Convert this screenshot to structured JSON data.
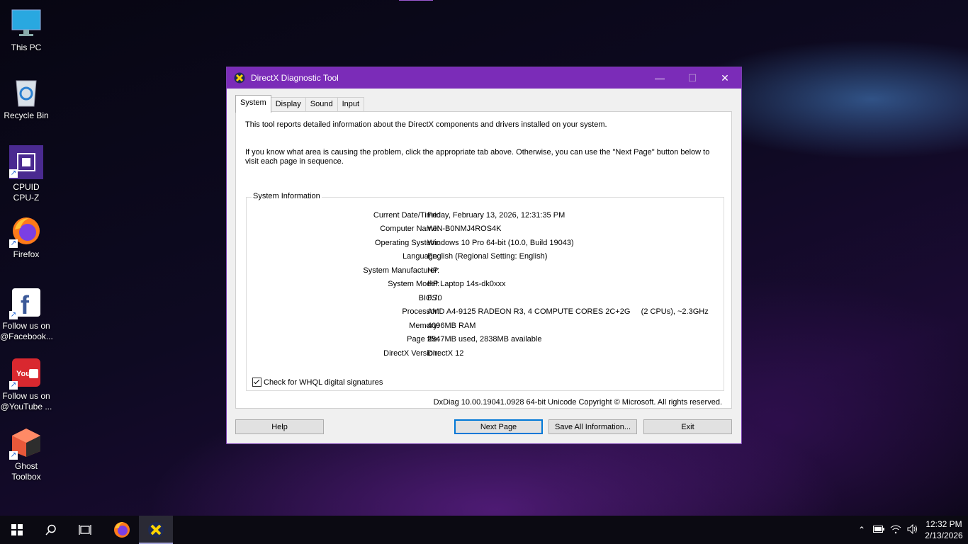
{
  "desktop": {
    "icons": [
      {
        "label": "This PC",
        "icon": "monitor-icon"
      },
      {
        "label": "Recycle Bin",
        "icon": "recycle-bin-icon"
      },
      {
        "label": "CPUID\nCPU-Z",
        "label_line1": "CPUID",
        "label_line2": "CPU-Z",
        "icon": "cpu-z-icon"
      },
      {
        "label": "Firefox",
        "icon": "firefox-icon"
      },
      {
        "label_line1": "Follow us on",
        "label_line2": "@Facebook...",
        "icon": "facebook-icon"
      },
      {
        "label_line1": "Follow us on",
        "label_line2": "@YouTube ...",
        "icon": "youtube-icon"
      },
      {
        "label_line1": "Ghost",
        "label_line2": "Toolbox",
        "icon": "ghost-toolbox-icon"
      }
    ]
  },
  "window": {
    "title": "DirectX Diagnostic Tool",
    "controls": {
      "minimize": "—",
      "maximize": "☐",
      "close": "✕"
    },
    "tabs": [
      "System",
      "Display",
      "Sound",
      "Input"
    ],
    "active_tab": "System",
    "intro_line1": "This tool reports detailed information about the DirectX components and drivers installed on your system.",
    "intro_line2": "If you know what area is causing the problem, click the appropriate tab above.  Otherwise, you can use the \"Next Page\" button below to",
    "intro_line3": "visit each page in sequence.",
    "group_title": "System Information",
    "info": [
      {
        "key": "Current Date/Time:",
        "value": "Friday, February 13, 2026, 12:31:35 PM"
      },
      {
        "key": "Computer Name:",
        "value": "WIN-B0NMJ4ROS4K"
      },
      {
        "key": "Operating System:",
        "value": "Windows 10 Pro 64-bit (10.0, Build 19043)"
      },
      {
        "key": "Language:",
        "value": "English (Regional Setting: English)"
      },
      {
        "key": "System Manufacturer:",
        "value": "HP"
      },
      {
        "key": "System Model:",
        "value": "HP Laptop 14s-dk0xxx"
      },
      {
        "key": "BIOS:",
        "value": "F.70"
      },
      {
        "key": "Processor:",
        "value": "AMD A4-9125 RADEON R3, 4 COMPUTE CORES 2C+2G     (2 CPUs), ~2.3GHz"
      },
      {
        "key": "Memory:",
        "value": "4096MB RAM"
      },
      {
        "key": "Page file:",
        "value": "2547MB used, 2838MB available"
      },
      {
        "key": "DirectX Version:",
        "value": "DirectX 12"
      }
    ],
    "checkbox_label": "Check for WHQL digital signatures",
    "checkbox_checked": true,
    "copyright": "DxDiag 10.00.19041.0928 64-bit Unicode  Copyright © Microsoft. All rights reserved.",
    "buttons": {
      "help": "Help",
      "next_page": "Next Page",
      "save_all": "Save All Information...",
      "exit": "Exit"
    }
  },
  "taskbar": {
    "items": [
      "start-icon",
      "search-icon",
      "task-view-icon",
      "firefox-icon",
      "directx-icon"
    ],
    "clock_time": "12:32 PM",
    "clock_date": "2/13/2026"
  },
  "colors": {
    "titlebar": "#7b2cb8",
    "accent": "#0078d7"
  }
}
